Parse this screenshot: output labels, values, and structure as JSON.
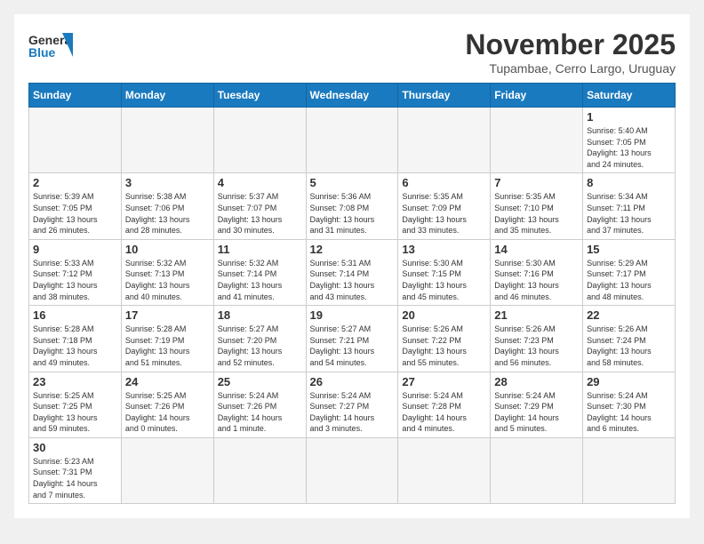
{
  "header": {
    "logo_general": "General",
    "logo_blue": "Blue",
    "month_title": "November 2025",
    "subtitle": "Tupambae, Cerro Largo, Uruguay"
  },
  "weekdays": [
    "Sunday",
    "Monday",
    "Tuesday",
    "Wednesday",
    "Thursday",
    "Friday",
    "Saturday"
  ],
  "weeks": [
    [
      {
        "day": "",
        "info": ""
      },
      {
        "day": "",
        "info": ""
      },
      {
        "day": "",
        "info": ""
      },
      {
        "day": "",
        "info": ""
      },
      {
        "day": "",
        "info": ""
      },
      {
        "day": "",
        "info": ""
      },
      {
        "day": "1",
        "info": "Sunrise: 5:40 AM\nSunset: 7:05 PM\nDaylight: 13 hours\nand 24 minutes."
      }
    ],
    [
      {
        "day": "2",
        "info": "Sunrise: 5:39 AM\nSunset: 7:05 PM\nDaylight: 13 hours\nand 26 minutes."
      },
      {
        "day": "3",
        "info": "Sunrise: 5:38 AM\nSunset: 7:06 PM\nDaylight: 13 hours\nand 28 minutes."
      },
      {
        "day": "4",
        "info": "Sunrise: 5:37 AM\nSunset: 7:07 PM\nDaylight: 13 hours\nand 30 minutes."
      },
      {
        "day": "5",
        "info": "Sunrise: 5:36 AM\nSunset: 7:08 PM\nDaylight: 13 hours\nand 31 minutes."
      },
      {
        "day": "6",
        "info": "Sunrise: 5:35 AM\nSunset: 7:09 PM\nDaylight: 13 hours\nand 33 minutes."
      },
      {
        "day": "7",
        "info": "Sunrise: 5:35 AM\nSunset: 7:10 PM\nDaylight: 13 hours\nand 35 minutes."
      },
      {
        "day": "8",
        "info": "Sunrise: 5:34 AM\nSunset: 7:11 PM\nDaylight: 13 hours\nand 37 minutes."
      }
    ],
    [
      {
        "day": "9",
        "info": "Sunrise: 5:33 AM\nSunset: 7:12 PM\nDaylight: 13 hours\nand 38 minutes."
      },
      {
        "day": "10",
        "info": "Sunrise: 5:32 AM\nSunset: 7:13 PM\nDaylight: 13 hours\nand 40 minutes."
      },
      {
        "day": "11",
        "info": "Sunrise: 5:32 AM\nSunset: 7:14 PM\nDaylight: 13 hours\nand 41 minutes."
      },
      {
        "day": "12",
        "info": "Sunrise: 5:31 AM\nSunset: 7:14 PM\nDaylight: 13 hours\nand 43 minutes."
      },
      {
        "day": "13",
        "info": "Sunrise: 5:30 AM\nSunset: 7:15 PM\nDaylight: 13 hours\nand 45 minutes."
      },
      {
        "day": "14",
        "info": "Sunrise: 5:30 AM\nSunset: 7:16 PM\nDaylight: 13 hours\nand 46 minutes."
      },
      {
        "day": "15",
        "info": "Sunrise: 5:29 AM\nSunset: 7:17 PM\nDaylight: 13 hours\nand 48 minutes."
      }
    ],
    [
      {
        "day": "16",
        "info": "Sunrise: 5:28 AM\nSunset: 7:18 PM\nDaylight: 13 hours\nand 49 minutes."
      },
      {
        "day": "17",
        "info": "Sunrise: 5:28 AM\nSunset: 7:19 PM\nDaylight: 13 hours\nand 51 minutes."
      },
      {
        "day": "18",
        "info": "Sunrise: 5:27 AM\nSunset: 7:20 PM\nDaylight: 13 hours\nand 52 minutes."
      },
      {
        "day": "19",
        "info": "Sunrise: 5:27 AM\nSunset: 7:21 PM\nDaylight: 13 hours\nand 54 minutes."
      },
      {
        "day": "20",
        "info": "Sunrise: 5:26 AM\nSunset: 7:22 PM\nDaylight: 13 hours\nand 55 minutes."
      },
      {
        "day": "21",
        "info": "Sunrise: 5:26 AM\nSunset: 7:23 PM\nDaylight: 13 hours\nand 56 minutes."
      },
      {
        "day": "22",
        "info": "Sunrise: 5:26 AM\nSunset: 7:24 PM\nDaylight: 13 hours\nand 58 minutes."
      }
    ],
    [
      {
        "day": "23",
        "info": "Sunrise: 5:25 AM\nSunset: 7:25 PM\nDaylight: 13 hours\nand 59 minutes."
      },
      {
        "day": "24",
        "info": "Sunrise: 5:25 AM\nSunset: 7:26 PM\nDaylight: 14 hours\nand 0 minutes."
      },
      {
        "day": "25",
        "info": "Sunrise: 5:24 AM\nSunset: 7:26 PM\nDaylight: 14 hours\nand 1 minute."
      },
      {
        "day": "26",
        "info": "Sunrise: 5:24 AM\nSunset: 7:27 PM\nDaylight: 14 hours\nand 3 minutes."
      },
      {
        "day": "27",
        "info": "Sunrise: 5:24 AM\nSunset: 7:28 PM\nDaylight: 14 hours\nand 4 minutes."
      },
      {
        "day": "28",
        "info": "Sunrise: 5:24 AM\nSunset: 7:29 PM\nDaylight: 14 hours\nand 5 minutes."
      },
      {
        "day": "29",
        "info": "Sunrise: 5:24 AM\nSunset: 7:30 PM\nDaylight: 14 hours\nand 6 minutes."
      }
    ],
    [
      {
        "day": "30",
        "info": "Sunrise: 5:23 AM\nSunset: 7:31 PM\nDaylight: 14 hours\nand 7 minutes."
      },
      {
        "day": "",
        "info": ""
      },
      {
        "day": "",
        "info": ""
      },
      {
        "day": "",
        "info": ""
      },
      {
        "day": "",
        "info": ""
      },
      {
        "day": "",
        "info": ""
      },
      {
        "day": "",
        "info": ""
      }
    ]
  ]
}
